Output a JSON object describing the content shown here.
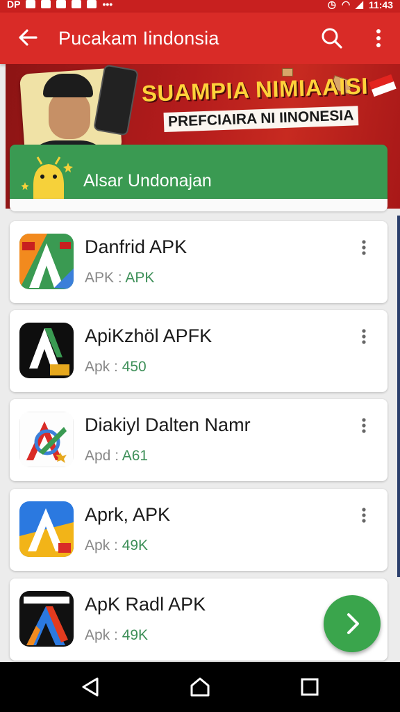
{
  "status_bar": {
    "left_text": "DP",
    "time": "11:43"
  },
  "app_bar": {
    "title": "Pucakam Iindonsia"
  },
  "banner": {
    "headline": "SUAMPIA NIMIAAISI",
    "subheadline": "PREFCIAIRA NI IINONESIA"
  },
  "promo": {
    "label": "Alsar Undonajan"
  },
  "apps": [
    {
      "name": "Danfrid APK",
      "meta_label": "APK",
      "meta_value": "APK",
      "icon": "a-orange-green-app-icon"
    },
    {
      "name": "ApiKzhöl APFK",
      "meta_label": "Apk",
      "meta_value": "450",
      "icon": "a-black-green-app-icon"
    },
    {
      "name": "Diakiyl Dalten Namr",
      "meta_label": "Apd",
      "meta_value": "A61",
      "icon": "a-white-multicolor-app-icon"
    },
    {
      "name": "Aprk, APK",
      "meta_label": "Apk",
      "meta_value": "49K",
      "icon": "a-blue-yellow-app-icon"
    },
    {
      "name": "ApK Radl APK",
      "meta_label": "Apk",
      "meta_value": "49K",
      "icon": "a-black-red-app-icon"
    }
  ],
  "colors": {
    "app_bar": "#d92b27",
    "promo": "#3a9a52",
    "fab": "#3aa54c",
    "value_text": "#3d8f58"
  }
}
